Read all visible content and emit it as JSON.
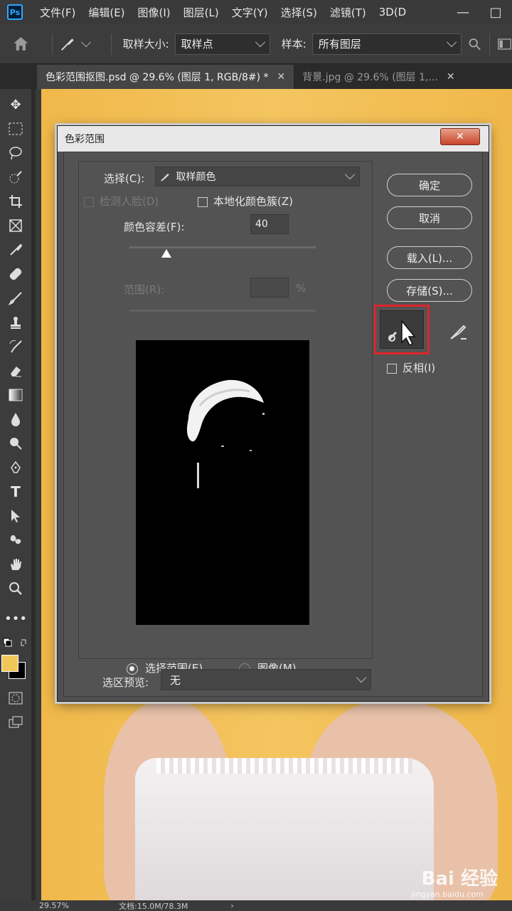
{
  "app": {
    "logo": "Ps"
  },
  "menu": [
    "文件(F)",
    "编辑(E)",
    "图像(I)",
    "图层(L)",
    "文字(Y)",
    "选择(S)",
    "滤镜(T)",
    "3D(D"
  ],
  "options": {
    "sample_size_label": "取样大小:",
    "sample_size_value": "取样点",
    "sample_label": "样本:",
    "sample_value": "所有图层"
  },
  "tabs": [
    {
      "label": "色彩范围抠图.psd @ 29.6% (图层 1, RGB/8#) *",
      "active": true
    },
    {
      "label": "背景.jpg @ 29.6% (图层 1,...",
      "active": false
    }
  ],
  "status": {
    "zoom": "29.57%",
    "doc": "文档:15.0M/78.3M"
  },
  "watermark": {
    "brand": "Bai 经验",
    "url": "jingyan.baidu.com"
  },
  "dialog": {
    "title": "色彩范围",
    "select_label": "选择(C):",
    "select_value": "取样颜色",
    "detect_faces": "检测人脸(D)",
    "localized_clusters": "本地化颜色簇(Z)",
    "fuzziness_label": "颜色容差(F):",
    "fuzziness_value": "40",
    "fuzziness_fraction": 0.2,
    "range_label": "范围(R):",
    "range_unit": "%",
    "radio_selection": "选择范围(E)",
    "radio_image": "图像(M)",
    "preview_label": "选区预览:",
    "preview_value": "无",
    "ok": "确定",
    "cancel": "取消",
    "load": "载入(L)...",
    "save": "存储(S)...",
    "invert": "反相(I)",
    "highlight_color": "#e0242b"
  }
}
